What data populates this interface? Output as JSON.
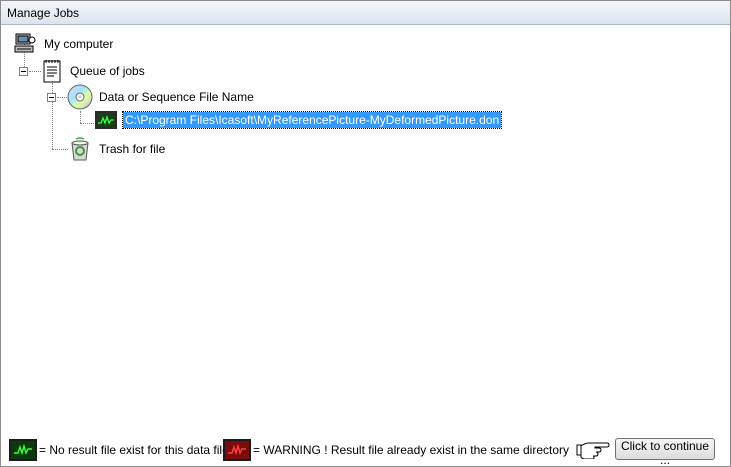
{
  "window": {
    "title": "Manage Jobs"
  },
  "tree": {
    "root": {
      "label": "My computer"
    },
    "queue": {
      "label": "Queue of jobs"
    },
    "data_group": {
      "label": "Data or Sequence File Name"
    },
    "file": {
      "label": "C:\\Program Files\\Icasoft\\MyReferencePicture-MyDeformedPicture.don"
    },
    "trash": {
      "label": "Trash for file"
    }
  },
  "legend": {
    "no_result": "= No result file exist for this data file",
    "warning": "= WARNING ! Result file already exist in the same directory"
  },
  "footer": {
    "continue_label": "Click to continue ..."
  },
  "colors": {
    "selection": "#3399ff",
    "ok_indicator": "#0d3a0d",
    "warn_indicator": "#7a0c0c",
    "signal_green": "#3cff3c",
    "signal_red": "#ff4040"
  }
}
